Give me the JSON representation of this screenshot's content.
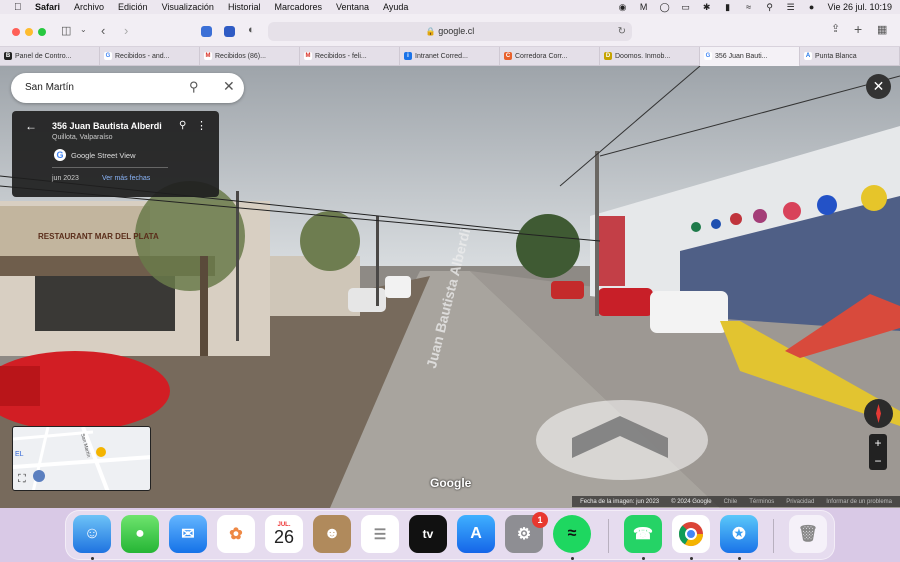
{
  "menubar": {
    "app": "Safari",
    "items": [
      "Archivo",
      "Edición",
      "Visualización",
      "Historial",
      "Marcadores",
      "Ventana",
      "Ayuda"
    ],
    "clock": "Vie 26 jul.  10:19"
  },
  "toolbar": {
    "url": "google.cl"
  },
  "tabs": [
    {
      "label": "Panel de Contro...",
      "icon": "B",
      "color": "#222"
    },
    {
      "label": "Recibidos - and...",
      "icon": "G",
      "color": "#4285f4"
    },
    {
      "label": "Recibidos (86)...",
      "icon": "M",
      "color": "#d93025"
    },
    {
      "label": "Recibidos - feli...",
      "icon": "M",
      "color": "#d93025"
    },
    {
      "label": "Intranet Corred...",
      "icon": "i",
      "color": "#1a73e8"
    },
    {
      "label": "Corredora Corr...",
      "icon": "C",
      "color": "#e8612c"
    },
    {
      "label": "Doomos. Inmob...",
      "icon": "D",
      "color": "#c5a300"
    },
    {
      "label": "356 Juan Bauti...",
      "icon": "G",
      "color": "#4285f4"
    },
    {
      "label": "Punta Blanca",
      "icon": "A",
      "color": "#1a73e8"
    }
  ],
  "streetview": {
    "search_value": "San Martín",
    "address": "356 Juan Bautista Alberdi",
    "city": "Quillota, Valparaíso",
    "source": "Google Street View",
    "date": "jun 2023",
    "more_dates": "Ver más fechas",
    "street_label": "Juan Bautista Alberdi",
    "store_sign": "RESTAURANT MAR DEL PLATA",
    "google_logo": "Google",
    "footer": {
      "image_date": "Fecha de la imagen: jun 2023",
      "copyright": "© 2024 Google",
      "country": "Chile",
      "terms": "Términos",
      "privacy": "Privacidad",
      "report": "Informar de un problema"
    },
    "minimap_label": "EL",
    "minimap_street": "San Martín"
  },
  "dock": {
    "calendar_month": "JUL.",
    "calendar_day": "26",
    "settings_badge": "1",
    "appletv_label": "tv"
  }
}
